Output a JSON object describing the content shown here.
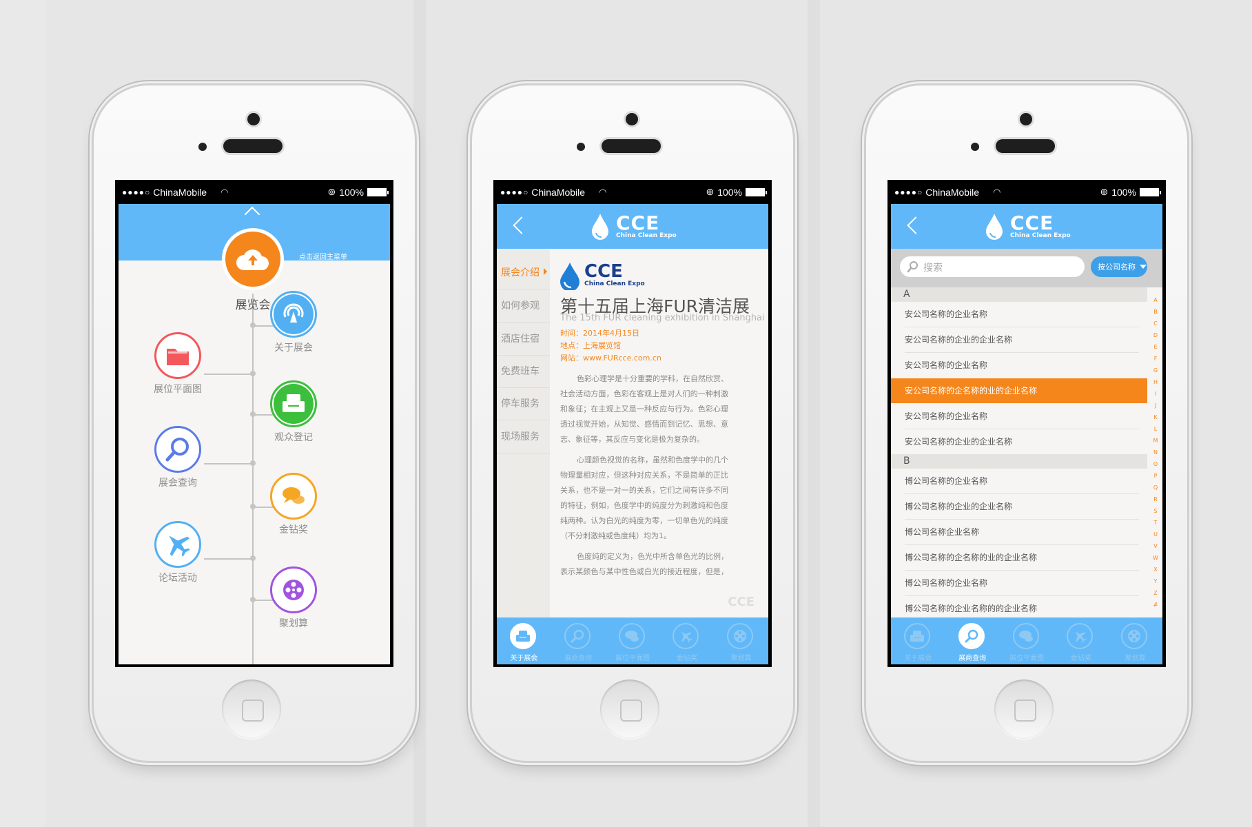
{
  "status_bar": {
    "carrier": "ChinaMobile",
    "battery": "100%"
  },
  "phone1": {
    "main": {
      "label": "展览会",
      "hint": "点击返回主菜单"
    },
    "menu": [
      {
        "label": "关于展会",
        "icon": "signal-icon",
        "color": "#52b0f2"
      },
      {
        "label": "展位平面图",
        "icon": "folder-icon",
        "color": "#f2585c"
      },
      {
        "label": "观众登记",
        "icon": "sofa-icon",
        "color": "#3cbf3c"
      },
      {
        "label": "展会查询",
        "icon": "search-icon",
        "color": "#5b7be6"
      },
      {
        "label": "金钻奖",
        "icon": "chat-icon",
        "color": "#f5a623"
      },
      {
        "label": "论坛活动",
        "icon": "airplane-icon",
        "color": "#52b0f2"
      },
      {
        "label": "聚划算",
        "icon": "film-reel-icon",
        "color": "#a154e0"
      }
    ]
  },
  "logo": {
    "main": "CCE",
    "sub": "China Clean Expo"
  },
  "phone2": {
    "sidebar": [
      "展会介绍",
      "如何参观",
      "酒店住宿",
      "免费班车",
      "停车服务",
      "现场服务"
    ],
    "title": "第十五届上海FUR清洁展",
    "subtitle": "The 15th FUR cleaning exhibition in Shanghai",
    "info": [
      "时间：2014年4月15日",
      "地点：上海展览馆",
      "网站：www.FURcce.com.cn"
    ],
    "paragraphs": [
      "色彩心理学是十分重要的学科，在自然欣赏、社会活动方面，色彩在客观上是对人们的一种刺激和象征；在主观上又是一种反应与行为。色彩心理透过视觉开始，从知觉、感情而到记忆、思想、意志、象征等，其反应与变化是极为复杂的。",
      "心理颜色视觉的名称，虽然和色度学中的几个物理量相对应，但这种对应关系，不是简单的正比关系，也不是一对一的关系，它们之间有许多不同的特征，例如，色度学中的纯度分为刺激纯和色度纯两种。认为白光的纯度为零，一切单色光的纯度（不分刺激纯或色度纯）均为1。",
      "色度纯的定义为，色光中所含单色光的比例，表示某颜色与某中性色或白光的接近程度，但是，心理颜色"
    ]
  },
  "tabs": [
    "关于展会",
    "展会查询",
    "展位平面图",
    "金钻奖",
    "聚划算"
  ],
  "tabs3": [
    "关于展会",
    "展商查询",
    "展位平面图",
    "金钻奖",
    "聚划算"
  ],
  "phone3": {
    "search_placeholder": "搜索",
    "sort_label": "按公司名称",
    "sectionA": "A",
    "sectionB": "B",
    "listA": [
      "安公司名称的企业名称",
      "安公司名称的企业的企业名称",
      "安公司名称的企业名称",
      "安公司名称的企名称的业的企业名称",
      "安公司名称的企业名称",
      "安公司名称的企业的企业名称"
    ],
    "listB": [
      "博公司名称的企业名称",
      "博公司名称的企业的企业名称",
      "博公司名称企业名称",
      "博公司名称的企名称的业的企业名称",
      "博公司名称的企业名称",
      "博公司名称的企业名称的的企业名称"
    ],
    "alphabet": [
      "A",
      "B",
      "C",
      "D",
      "E",
      "F",
      "G",
      "H",
      "I",
      "J",
      "K",
      "L",
      "M",
      "N",
      "O",
      "P",
      "Q",
      "R",
      "S",
      "T",
      "U",
      "V",
      "W",
      "X",
      "Y",
      "Z",
      "#"
    ]
  },
  "colors": {
    "accent_blue": "#60b8f8",
    "accent_orange": "#f5861c",
    "bg": "#f6f5f3"
  }
}
